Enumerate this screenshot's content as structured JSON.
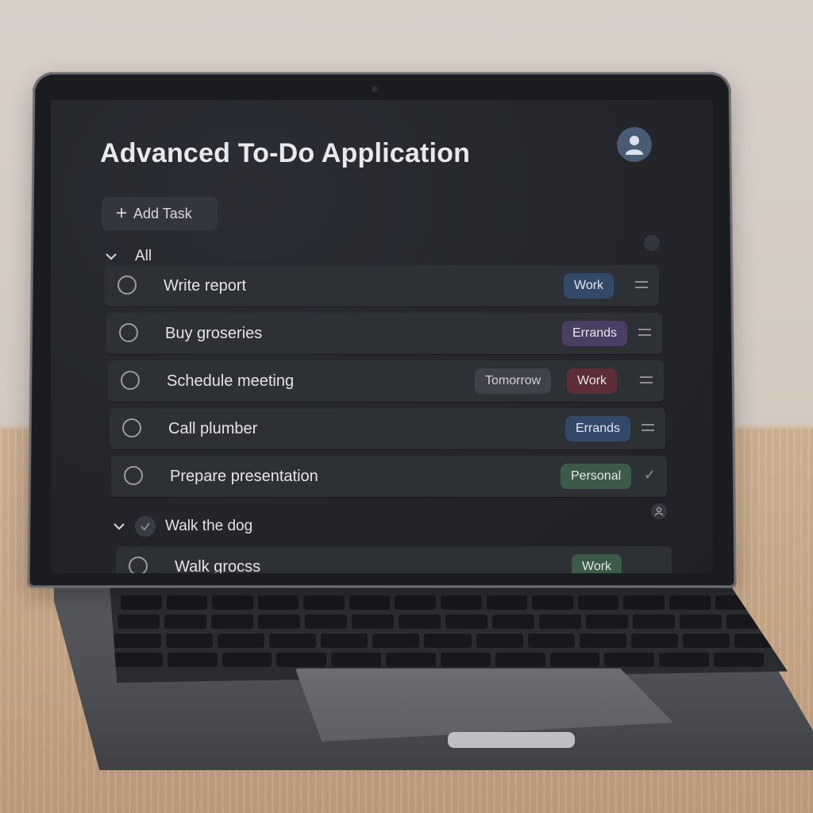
{
  "app": {
    "title": "Advanced To-Do Application",
    "add_task_label": "Add Task",
    "add_task_icon": "+"
  },
  "group": {
    "label": "All",
    "tasks": [
      {
        "title": "Write report",
        "tags": [
          "Work"
        ],
        "action": "drag-handle"
      },
      {
        "title": "Buy groseries",
        "tags": [
          "Errands"
        ],
        "action": "drag-handle"
      },
      {
        "title": "Schedule meeting",
        "tags": [
          "Tomorrow",
          "Work"
        ],
        "action": "drag-handle"
      },
      {
        "title": "Call plumber",
        "tags": [
          "Errands"
        ],
        "action": "drag-handle"
      },
      {
        "title": "Prepare presentation",
        "tags": [
          "Personal"
        ],
        "action": "check-mark"
      }
    ]
  },
  "subgroup": {
    "label": "Walk the dog",
    "tasks": [
      {
        "title": "Walk grocss",
        "tags": [
          "Work"
        ]
      }
    ]
  },
  "colors": {
    "screen_bg": "#23252a",
    "task_bg": "#2d3035",
    "tag_work": "#33496a",
    "tag_errands": "#4a3e63",
    "tag_personal": "#3b5a48",
    "tag_work_alt": "#5e2e38",
    "tag_date": "#3f4248"
  },
  "icons": [
    "user-avatar-icon",
    "plus-icon",
    "chevron-down-icon",
    "filter-icon",
    "drag-handle-icon",
    "checkmark-icon",
    "user-mini-icon"
  ]
}
